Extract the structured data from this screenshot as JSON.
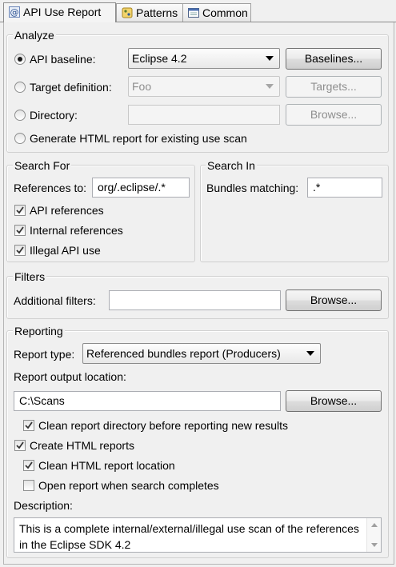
{
  "tabs": [
    {
      "label": "API Use Report",
      "icon": "at-sign-icon",
      "active": true
    },
    {
      "label": "Patterns",
      "icon": "patterns-icon",
      "active": false
    },
    {
      "label": "Common",
      "icon": "common-window-icon",
      "active": false
    }
  ],
  "analyze": {
    "title": "Analyze",
    "api_baseline": {
      "label": "API baseline:",
      "selected": true,
      "value": "Eclipse 4.2",
      "button": "Baselines..."
    },
    "target_definition": {
      "label": "Target definition:",
      "selected": false,
      "value": "Foo",
      "button": "Targets..."
    },
    "directory": {
      "label": "Directory:",
      "selected": false,
      "value": "",
      "button": "Browse..."
    },
    "generate": {
      "label": "Generate HTML report for existing use scan",
      "selected": false
    }
  },
  "search_for": {
    "title": "Search For",
    "references_label": "References to:",
    "references_value": "org/.eclipse/.*",
    "api_references": {
      "label": "API references",
      "checked": true
    },
    "internal_references": {
      "label": "Internal references",
      "checked": true
    },
    "illegal_api_use": {
      "label": "Illegal API use",
      "checked": true
    }
  },
  "search_in": {
    "title": "Search In",
    "bundles_label": "Bundles matching:",
    "bundles_value": ".*"
  },
  "filters": {
    "title": "Filters",
    "additional_label": "Additional filters:",
    "additional_value": "",
    "button": "Browse..."
  },
  "reporting": {
    "title": "Reporting",
    "report_type_label": "Report type:",
    "report_type_value": "Referenced bundles report (Producers)",
    "output_location_label": "Report output location:",
    "output_location_value": "C:\\Scans",
    "browse_button": "Browse...",
    "clean_report_dir": {
      "label": "Clean report directory before reporting new results",
      "checked": true
    },
    "create_html": {
      "label": "Create HTML reports",
      "checked": true
    },
    "clean_html": {
      "label": "Clean HTML report location",
      "checked": true
    },
    "open_report": {
      "label": "Open report when search completes",
      "checked": false
    },
    "description_label": "Description:",
    "description_value": "This is a complete internal/external/illegal use scan of the references in the Eclipse SDK 4.2"
  },
  "colors": {
    "accent": "#3b3b3b",
    "disabled_text": "#8e8e8e",
    "background": "#f0f0f0"
  }
}
